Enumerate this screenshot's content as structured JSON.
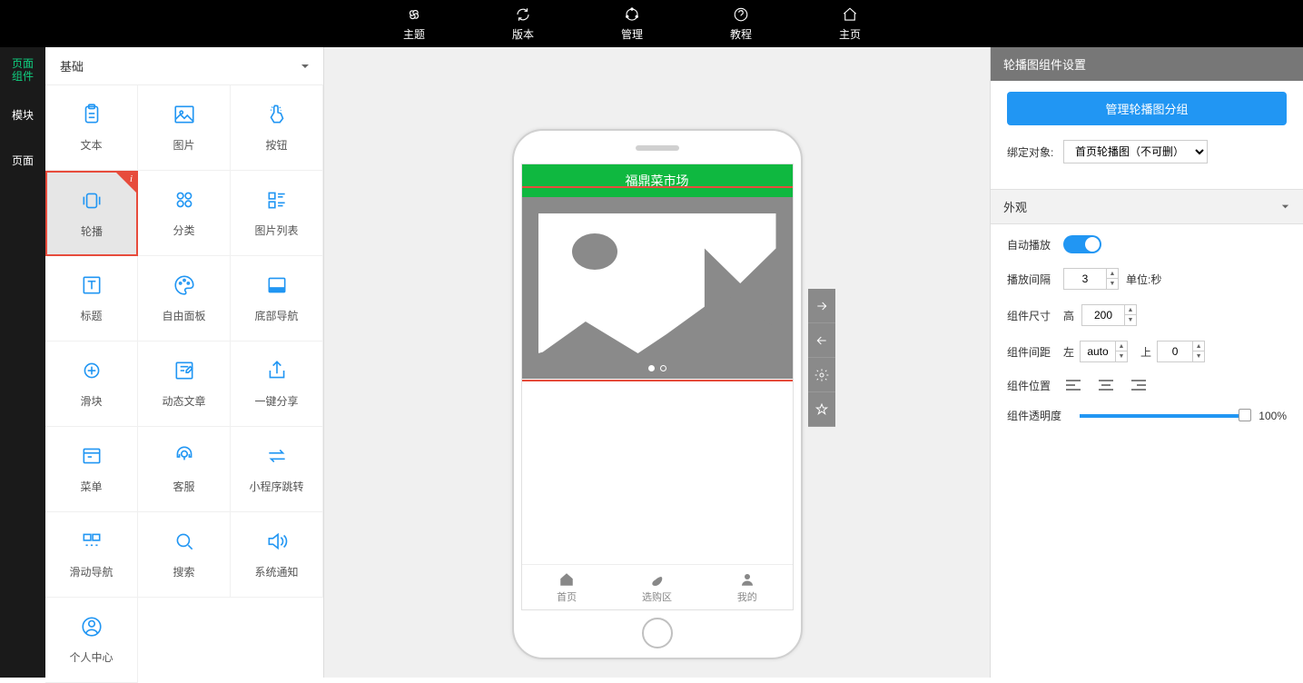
{
  "topbar": {
    "items": [
      {
        "label": "主题"
      },
      {
        "label": "版本"
      },
      {
        "label": "管理"
      },
      {
        "label": "教程"
      },
      {
        "label": "主页"
      }
    ]
  },
  "leftnav": {
    "items": [
      {
        "label": "页面组件",
        "active": true
      },
      {
        "label": "模块"
      },
      {
        "label": "页面"
      }
    ]
  },
  "comp_panel": {
    "header": "基础",
    "items": [
      {
        "label": "文本"
      },
      {
        "label": "图片"
      },
      {
        "label": "按钮"
      },
      {
        "label": "轮播",
        "selected": true
      },
      {
        "label": "分类"
      },
      {
        "label": "图片列表"
      },
      {
        "label": "标题"
      },
      {
        "label": "自由面板"
      },
      {
        "label": "底部导航"
      },
      {
        "label": "滑块"
      },
      {
        "label": "动态文章"
      },
      {
        "label": "一键分享"
      },
      {
        "label": "菜单"
      },
      {
        "label": "客服"
      },
      {
        "label": "小程序跳转"
      },
      {
        "label": "滑动导航"
      },
      {
        "label": "搜索"
      },
      {
        "label": "系统通知"
      },
      {
        "label": "个人中心"
      }
    ]
  },
  "phone": {
    "app_title": "福鼎菜市场",
    "tabs": [
      {
        "label": "首页"
      },
      {
        "label": "选购区"
      },
      {
        "label": "我的"
      }
    ]
  },
  "props": {
    "panel_title": "轮播图组件设置",
    "manage_btn": "管理轮播图分组",
    "bind_label": "绑定对象:",
    "bind_value": "首页轮播图（不可删）",
    "section_appearance": "外观",
    "autoplay_label": "自动播放",
    "interval_label": "播放间隔",
    "interval_value": "3",
    "interval_unit": "单位:秒",
    "size_label": "组件尺寸",
    "size_h_label": "高",
    "size_h_value": "200",
    "margin_label": "组件间距",
    "margin_l_label": "左",
    "margin_l_value": "auto",
    "margin_t_label": "上",
    "margin_t_value": "0",
    "position_label": "组件位置",
    "opacity_label": "组件透明度",
    "opacity_value": "100%"
  }
}
